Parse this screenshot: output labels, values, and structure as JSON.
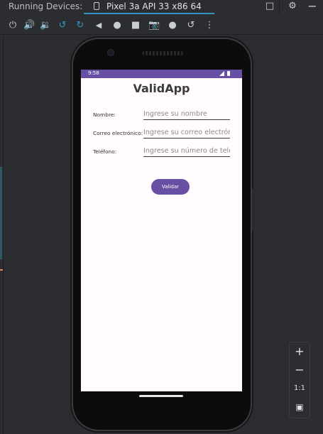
{
  "tabbar": {
    "title": "Running Devices:",
    "device_tab": "Pixel 3a API 33 x86 64"
  },
  "toolbar": {
    "icons": [
      "power-icon",
      "volume-up-icon",
      "volume-down-icon",
      "rotate-left-icon",
      "rotate-right-icon",
      "back-icon",
      "home-icon",
      "overview-icon",
      "screenshot-icon",
      "screen-record-icon",
      "snapshot-icon",
      "more-options-icon"
    ]
  },
  "device": {
    "status_time": "9:58",
    "app": {
      "title": "ValidApp",
      "fields": [
        {
          "label": "Nombre:",
          "placeholder": "Ingrese su nombre"
        },
        {
          "label": "Correo electrónico:",
          "placeholder": "Ingrese su correo electrón"
        },
        {
          "label": "Teléfono:",
          "placeholder": "Ingrese su número de telé"
        }
      ],
      "validate_label": "Validar"
    }
  },
  "zoom": {
    "zoom_in": "+",
    "zoom_out": "−",
    "actual_size": "1:1"
  },
  "colors": {
    "primary": "#6750a4",
    "tab_underline": "#3592c4",
    "ide_background": "#2b2d30"
  }
}
